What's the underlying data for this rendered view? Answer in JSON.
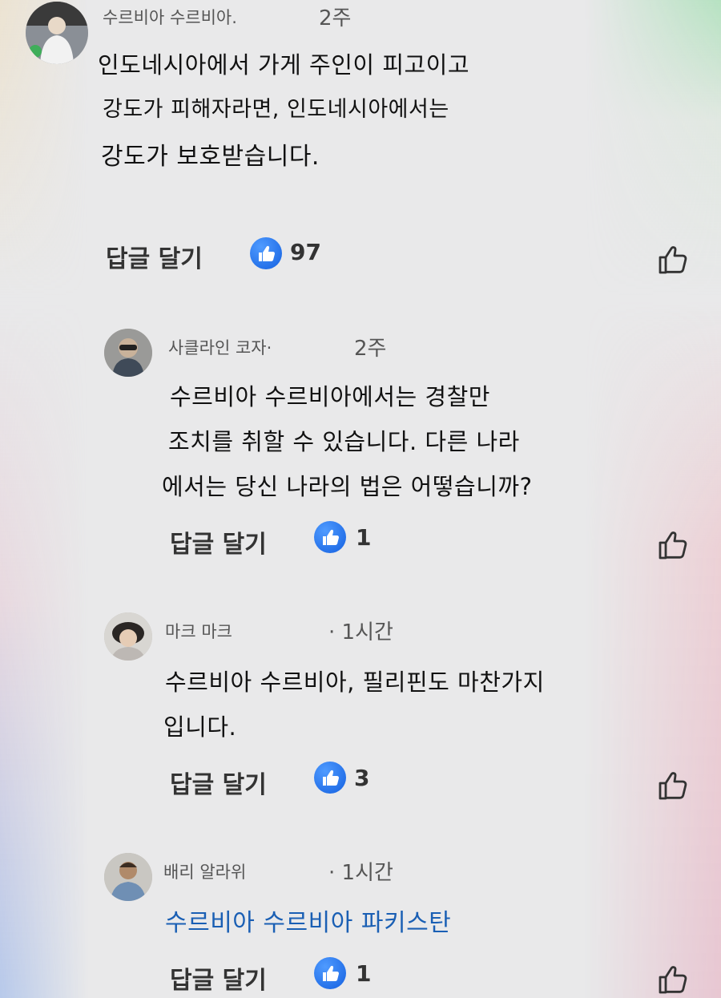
{
  "reply_label": "답글 달기",
  "accent_color": "#1877f2",
  "icons": {
    "like_badge": "thumbs-up-badge-icon",
    "like_button": "thumbs-up-outline-icon"
  },
  "comments": [
    {
      "author": "수르비아 수르비아.",
      "time": "2주",
      "lines": [
        "인도네시아에서 가게 주인이 피고이고",
        "강도가 피해자라면, 인도네시아에서는",
        "강도가 보호받습니다."
      ],
      "likes": "97"
    },
    {
      "author": "사클라인 코자·",
      "time": "2주",
      "lines": [
        "수르비아 수르비아에서는 경찰만",
        "조치를 취할 수 있습니다. 다른 나라",
        "에서는 당신 나라의 법은 어떻습니까?"
      ],
      "likes": "1"
    },
    {
      "author": "마크 마크",
      "time": "· 1시간",
      "lines": [
        "수르비아 수르비아, 필리핀도 마찬가지",
        "입니다."
      ],
      "likes": "3"
    },
    {
      "author": "배리 알라위",
      "time": "· 1시간",
      "lines": [
        "수르비아 수르비아 파키스탄"
      ],
      "likes": "1"
    }
  ]
}
